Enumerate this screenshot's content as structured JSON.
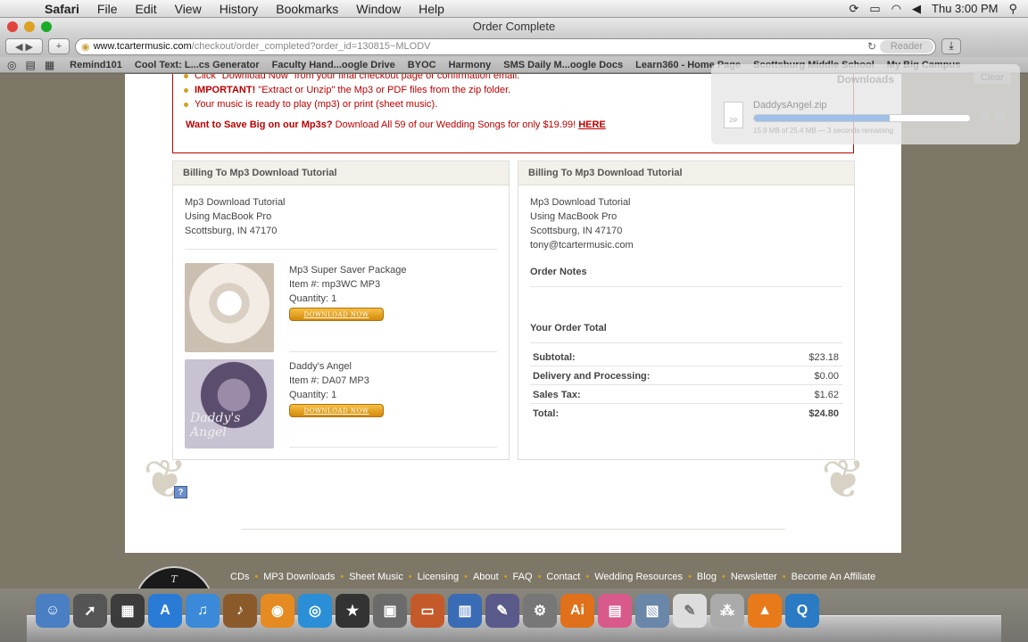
{
  "menubar": {
    "app": "Safari",
    "items": [
      "File",
      "Edit",
      "View",
      "History",
      "Bookmarks",
      "Window",
      "Help"
    ],
    "clock": "Thu 3:00 PM"
  },
  "window": {
    "title": "Order Complete"
  },
  "address": {
    "domain": "www.tcartermusic.com",
    "path": "/checkout/order_completed?order_id=130815~MLODV",
    "reader": "Reader"
  },
  "bookmarks": [
    "Remind101",
    "Cool Text: L...cs Generator",
    "Faculty Hand...oogle Drive",
    "BYOC",
    "Harmony",
    "SMS Daily M...oogle Docs",
    "Learn360 - Home Page",
    "Scottsburg Middle School",
    "My Big Campus"
  ],
  "notice": {
    "item_partial": "Click \"Download Now\" from your final checkout page or confirmation email.",
    "important_label": "IMPORTANT!",
    "important_text": " \"Extract or Unzip\" the Mp3 or PDF files from the zip folder.",
    "ready_text": "Your music is ready to play (mp3) or print (sheet music).",
    "promo_bold": "Want to Save Big on our Mp3s?",
    "promo_text": " Download All 59 of our Wedding Songs for only $19.99! ",
    "promo_link": "HERE"
  },
  "billing": {
    "header": "Billing To Mp3 Download Tutorial",
    "line1": "Mp3 Download Tutorial",
    "line2": "Using MacBook Pro",
    "line3": "Scottsburg, IN 47170"
  },
  "items": [
    {
      "name": "Mp3 Super Saver Package",
      "item_no": "Item #: mp3WC MP3",
      "qty": "Quantity: 1",
      "button": "DOWNLOAD NOW"
    },
    {
      "name": "Daddy's Angel",
      "item_no": "Item #: DA07 MP3",
      "qty": "Quantity: 1",
      "button": "DOWNLOAD NOW",
      "img_text": "Daddy's Angel"
    }
  ],
  "shipping": {
    "header": "Billing To Mp3 Download Tutorial",
    "line1": "Mp3 Download Tutorial",
    "line2": "Using MacBook Pro",
    "line3": "Scottsburg, IN 47170",
    "email": "tony@tcartermusic.com",
    "order_notes": "Order Notes",
    "order_total": "Your Order Total"
  },
  "summary": [
    {
      "label": "Subtotal:",
      "value": "$23.18"
    },
    {
      "label": "Delivery and Processing:",
      "value": "$0.00"
    },
    {
      "label": "Sales Tax:",
      "value": "$1.62"
    },
    {
      "label": "Total:",
      "value": "$24.80"
    }
  ],
  "footer_nav": [
    "CDs",
    "MP3 Downloads",
    "Sheet Music",
    "Licensing",
    "About",
    "FAQ",
    "Contact",
    "Wedding Resources",
    "Blog",
    "Newsletter",
    "Become An Affiliate"
  ],
  "downloads": {
    "title": "Downloads",
    "clear": "Clear",
    "filename": "DaddysAngel.zip",
    "status": "15.9 MB of 25.4 MB — 3 seconds remaining",
    "progress": 0.63,
    "icon_label": "ZIP"
  },
  "help_label": "?"
}
